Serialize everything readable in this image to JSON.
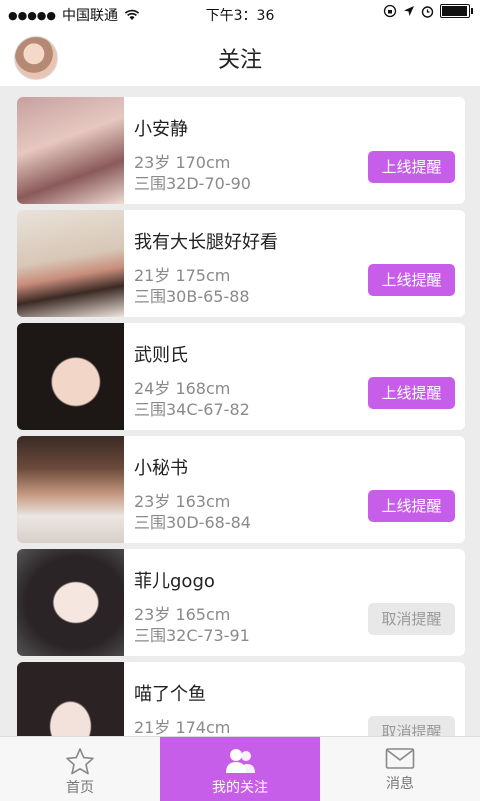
{
  "status": {
    "signal_dots": "●●●●●",
    "carrier": "中国联通",
    "time": "下午3：36"
  },
  "header": {
    "title": "关注"
  },
  "cards": [
    {
      "name": "小安静",
      "age": "23岁 170cm",
      "measure": "三围32D-70-90",
      "button": "上线提醒",
      "state": "on"
    },
    {
      "name": "我有大长腿好好看",
      "age": "21岁 175cm",
      "measure": "三围30B-65-88",
      "button": "上线提醒",
      "state": "on"
    },
    {
      "name": "武则氏",
      "age": "24岁 168cm",
      "measure": "三围34C-67-82",
      "button": "上线提醒",
      "state": "on"
    },
    {
      "name": "小秘书",
      "age": "23岁 163cm",
      "measure": "三围30D-68-84",
      "button": "上线提醒",
      "state": "on"
    },
    {
      "name": "菲儿gogo",
      "age": "23岁 165cm",
      "measure": "三围32C-73-91",
      "button": "取消提醒",
      "state": "off"
    },
    {
      "name": "喵了个鱼",
      "age": "21岁 174cm",
      "measure": "",
      "button": "取消提醒",
      "state": "off"
    }
  ],
  "tabs": [
    {
      "label": "首页",
      "icon": "star-icon"
    },
    {
      "label": "我的关注",
      "icon": "users-icon"
    },
    {
      "label": "消息",
      "icon": "mail-icon"
    }
  ],
  "colors": {
    "accent": "#c75ee9",
    "inactive_button": "#e8e8e8"
  }
}
